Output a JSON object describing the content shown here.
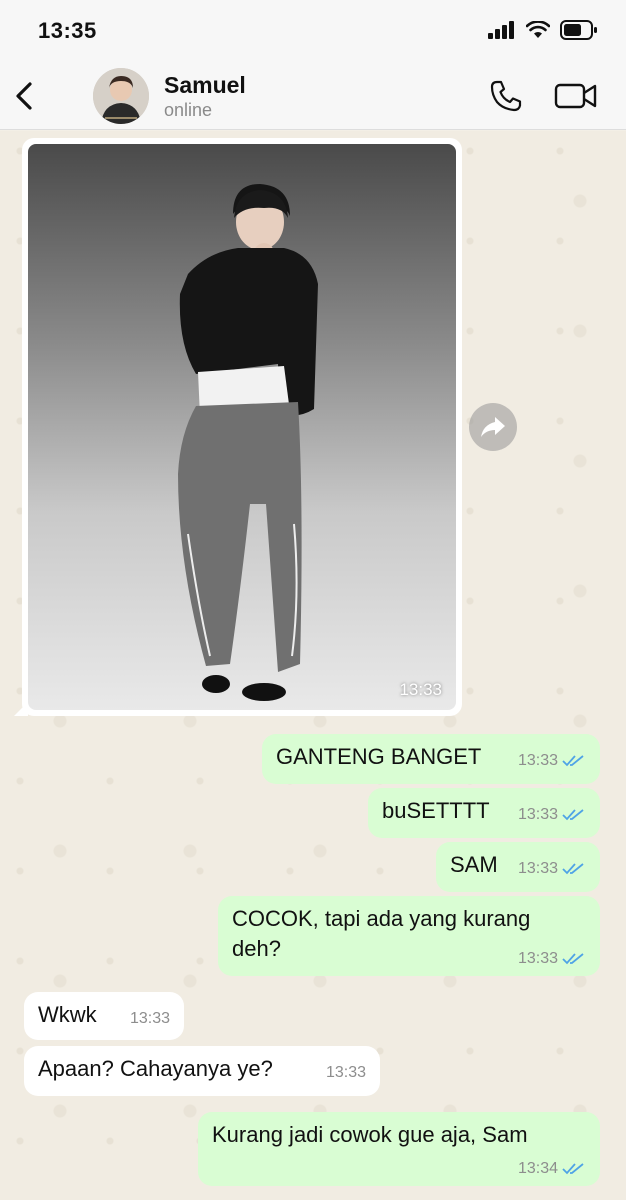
{
  "status_bar": {
    "time": "13:35"
  },
  "header": {
    "contact_name": "Samuel",
    "contact_status": "online"
  },
  "photo_message": {
    "time": "13:33"
  },
  "messages": [
    {
      "direction": "out",
      "text": "GANTENG BANGET",
      "time": "13:33"
    },
    {
      "direction": "out",
      "text": "buSETTTT",
      "time": "13:33"
    },
    {
      "direction": "out",
      "text": "SAM",
      "time": "13:33"
    },
    {
      "direction": "out",
      "text": "COCOK, tapi ada yang kurang deh?",
      "time": "13:33"
    },
    {
      "direction": "in",
      "text": "Wkwk",
      "time": "13:33"
    },
    {
      "direction": "in",
      "text": "Apaan? Cahayanya ye?",
      "time": "13:33"
    },
    {
      "direction": "out",
      "text": "Kurang jadi cowok gue aja, Sam",
      "time": "13:34"
    }
  ],
  "colors": {
    "outgoing_bubble": "#d9fdd3",
    "incoming_bubble": "#ffffff",
    "read_ticks": "#4fa3e6",
    "chat_background": "#f1ece2"
  },
  "icons": [
    "signal-icon",
    "wifi-icon",
    "battery-icon",
    "back-arrow-icon",
    "phone-icon",
    "video-camera-icon",
    "forward-icon",
    "double-check-icon"
  ]
}
